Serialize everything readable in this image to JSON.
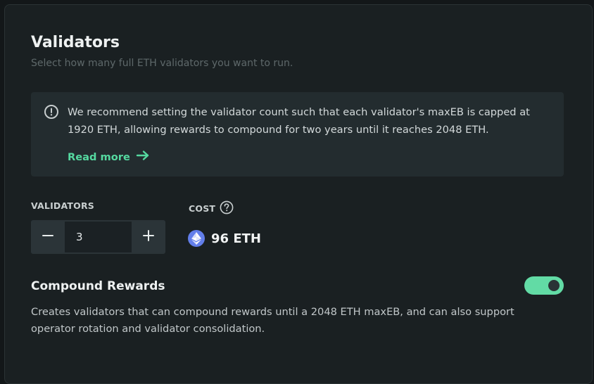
{
  "header": {
    "title": "Validators",
    "subtitle": "Select how many full ETH validators you want to run."
  },
  "notice": {
    "icon": "alert-circle-icon",
    "text": "We recommend setting the validator count such that each validator's maxEB is capped at 1920 ETH, allowing rewards to compound for two years until it reaches 2048 ETH.",
    "link_label": "Read more",
    "link_icon": "arrow-right-icon"
  },
  "validators": {
    "label": "VALIDATORS",
    "value": "3",
    "decrement_icon": "minus-icon",
    "increment_icon": "plus-icon"
  },
  "cost": {
    "label": "COST",
    "help_icon": "question-circle-icon",
    "token_icon": "ethereum-icon",
    "value": "96 ETH"
  },
  "compound": {
    "title": "Compound Rewards",
    "enabled": true,
    "description": "Creates validators that can compound rewards until a 2048 ETH maxEB, and can also support operator rotation and validator consolidation."
  },
  "colors": {
    "accent": "#55d9a0",
    "toggle_on": "#62dba5",
    "background": "#1a2022",
    "notice_bg": "#232c2f",
    "eth_blue": "#627eea"
  }
}
